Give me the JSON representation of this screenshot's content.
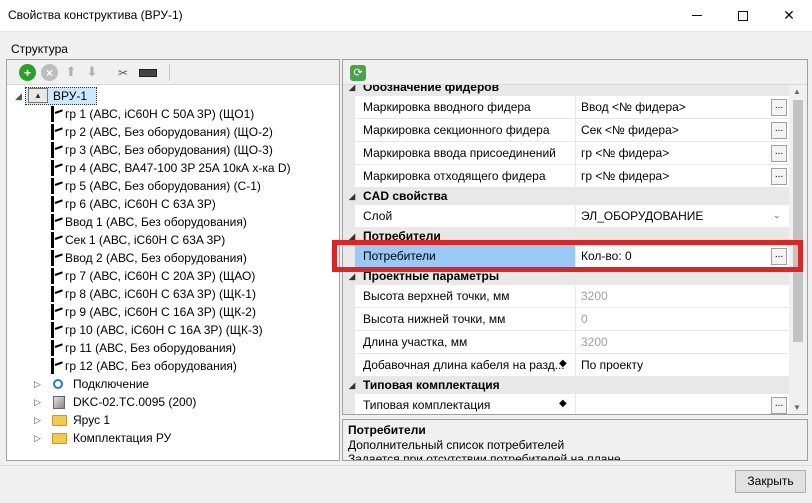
{
  "window": {
    "title": "Свойства конструктива (ВРУ-1)",
    "structure_label": "Структура",
    "close_button": "Закрыть"
  },
  "toolbar": {
    "add_icon": "add-icon",
    "remove_icon": "remove-icon",
    "up_icon": "arrow-up-icon",
    "down_icon": "arrow-down-icon",
    "tool_icon": "tool-icon",
    "ruler_icon": "ruler-icon"
  },
  "tree": {
    "root": "ВРУ-1",
    "feeders": [
      "гр 1 (АВС, iC60H C 50A 3P)   (ЩО1)",
      "гр 2 (АВС, Без оборудования)   (ЩО-2)",
      "гр 3 (АВС, Без оборудования)   (ЩО-3)",
      "гр 4 (АВС, ВА47-100 3P 25A 10кА х-ка D)",
      "гр 5 (АВС, Без оборудования)   (С-1)",
      "гр 6 (АВС, iC60H C 63A 3P)",
      "Ввод 1 (АВС, Без оборудования)",
      "Сек 1 (АВС, iC60H C 63A 3P)",
      "Ввод 2 (АВС, Без оборудования)",
      "гр 7 (АВС, iC60H C 20A 3P)   (ЩАО)",
      "гр 8 (АВС, iC60H C 63A 3P)   (ЩК-1)",
      "гр 9 (АВС, iC60H C 16A 3P)   (ЩК-2)",
      "гр 10 (АВС, iC60H C 16A 3P)   (ЩК-3)",
      "гр 11 (АВС, Без оборудования)",
      "гр 12 (АВС, Без оборудования)"
    ],
    "others": [
      {
        "label": "Подключение",
        "icon": "circle-icon"
      },
      {
        "label": "DKC-02.TC.0095 (200)",
        "icon": "cube-icon"
      },
      {
        "label": "Ярус 1",
        "icon": "folder-icon"
      },
      {
        "label": "Комплектация РУ",
        "icon": "folder-icon"
      }
    ]
  },
  "grid": {
    "cat0": "Обозначение фидеров",
    "rows0": [
      {
        "name": "Маркировка вводного фидера",
        "value": "Ввод <№ фидера>"
      },
      {
        "name": "Маркировка секционного фидера",
        "value": "Сек <№ фидера>"
      },
      {
        "name": "Маркировка ввода присоединений",
        "value": "гр <№ фидера>"
      },
      {
        "name": "Маркировка отходящего фидера",
        "value": "гр <№ фидера>"
      }
    ],
    "cat1": "CAD свойства",
    "layer": {
      "name": "Слой",
      "value": "ЭЛ_ОБОРУДОВАНИЕ"
    },
    "cat2": "Потребители",
    "consumers": {
      "name": "Потребители",
      "value": "Кол-во: 0"
    },
    "cat3": "Проектные параметры",
    "rows3": [
      {
        "name": "Высота верхней точки, мм",
        "value": "3200"
      },
      {
        "name": "Высота нижней точки, мм",
        "value": "0"
      },
      {
        "name": "Длина участка, мм",
        "value": "3200"
      },
      {
        "name": "Добавочная длина кабеля на разд...",
        "value": "По проекту"
      }
    ],
    "cat4": "Типовая комплектация",
    "typical": {
      "name": "Типовая комплектация",
      "value": ""
    }
  },
  "description": {
    "title": "Потребители",
    "line1": "Дополнительный список потребителей",
    "line2": "Задается при отсутствии потребителей на плане"
  }
}
